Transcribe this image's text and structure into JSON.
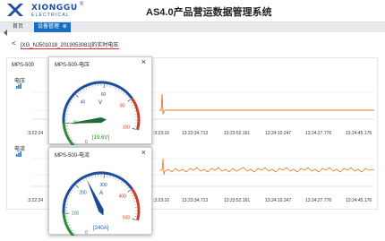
{
  "header": {
    "brand_name": "XIONGGU",
    "brand_reg": "®",
    "brand_sub": "ELECTRICAL",
    "app_title": "AS4.0产品营运数据管理系统"
  },
  "nav": {
    "home_label": "首页",
    "device_mgmt_label": "设备管理",
    "close_glyph": "⊗"
  },
  "page": {
    "back_glyph": "<",
    "title": "[XG_NJ501018_2019053081]的实时电压"
  },
  "panel": {
    "device_label": "MPS-500",
    "voltage_label": "电压",
    "current_label": "电流",
    "voltage_axis_ticks": [
      ":3:22:24",
      ":3:23:16",
      "13:23:34.713",
      "13:23:52.161",
      "13:24:10.247",
      "13:24:27.776",
      "13:24:45.176"
    ],
    "current_axis_ticks": [
      ":3:22:24",
      ":3:23:16",
      "13:23:34.713",
      "13:23:52.161",
      "13:24:10.247",
      "13:24:27.776",
      "13:24:45.176"
    ],
    "line_color": "#e8762a"
  },
  "dialog_voltage": {
    "title": "MPS-500-电压",
    "close_glyph": "×",
    "gauge_labels": [
      "0",
      "20",
      "40",
      "60",
      "80",
      "100"
    ],
    "unit": "V",
    "readout": "[19.6V]",
    "value": 19.6,
    "max": 100,
    "needle_color": "#1f6b3a"
  },
  "dialog_current": {
    "title": "MPS-500-电流",
    "close_glyph": "×",
    "gauge_labels": [
      "0",
      "100",
      "200",
      "300",
      "400",
      "500"
    ],
    "unit": "A",
    "readout": "[240A]",
    "value": 240,
    "max": 500,
    "needle_color": "#1a4c8f"
  },
  "colors": {
    "accent": "#1a6ec1",
    "gauge_green": "#2e8b3a",
    "gauge_blue": "#1f4e9e",
    "gauge_red": "#d23a2a"
  }
}
